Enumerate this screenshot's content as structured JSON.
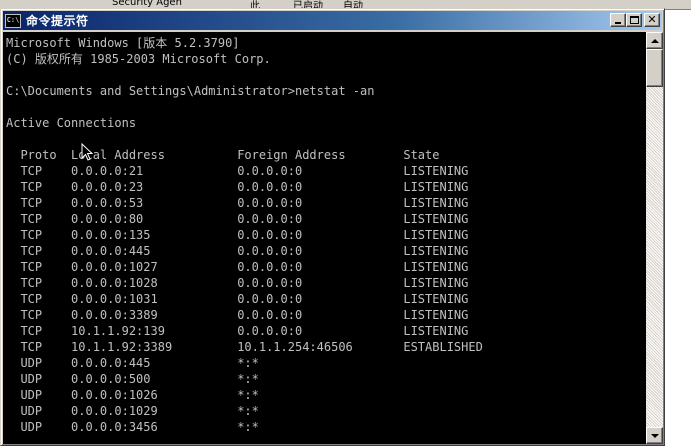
{
  "background_window": {
    "fragments": [
      "Security Agen",
      "此",
      "已启动",
      "自动"
    ]
  },
  "window": {
    "title": "命令提示符",
    "icon_label": "C:\\"
  },
  "console": {
    "lines": [
      "Microsoft Windows [版本 5.2.3790]",
      "(C) 版权所有 1985-2003 Microsoft Corp.",
      "",
      "C:\\Documents and Settings\\Administrator>netstat -an",
      "",
      "Active Connections",
      "",
      "  Proto  Local Address          Foreign Address        State",
      "  TCP    0.0.0.0:21             0.0.0.0:0              LISTENING",
      "  TCP    0.0.0.0:23             0.0.0.0:0              LISTENING",
      "  TCP    0.0.0.0:53             0.0.0.0:0              LISTENING",
      "  TCP    0.0.0.0:80             0.0.0.0:0              LISTENING",
      "  TCP    0.0.0.0:135            0.0.0.0:0              LISTENING",
      "  TCP    0.0.0.0:445            0.0.0.0:0              LISTENING",
      "  TCP    0.0.0.0:1027           0.0.0.0:0              LISTENING",
      "  TCP    0.0.0.0:1028           0.0.0.0:0              LISTENING",
      "  TCP    0.0.0.0:1031           0.0.0.0:0              LISTENING",
      "  TCP    0.0.0.0:3389           0.0.0.0:0              LISTENING",
      "  TCP    10.1.1.92:139          0.0.0.0:0              LISTENING",
      "  TCP    10.1.1.92:3389         10.1.1.254:46506       ESTABLISHED",
      "  UDP    0.0.0.0:445            *:*",
      "  UDP    0.0.0.0:500            *:*",
      "  UDP    0.0.0.0:1026           *:*",
      "  UDP    0.0.0.0:1029           *:*",
      "  UDP    0.0.0.0:3456           *:*"
    ]
  },
  "colors": {
    "console_bg": "#000000",
    "console_fg": "#c0c0c0",
    "titlebar_start": "#0a246a",
    "titlebar_end": "#a6caf0",
    "chrome": "#d4d0c8"
  }
}
